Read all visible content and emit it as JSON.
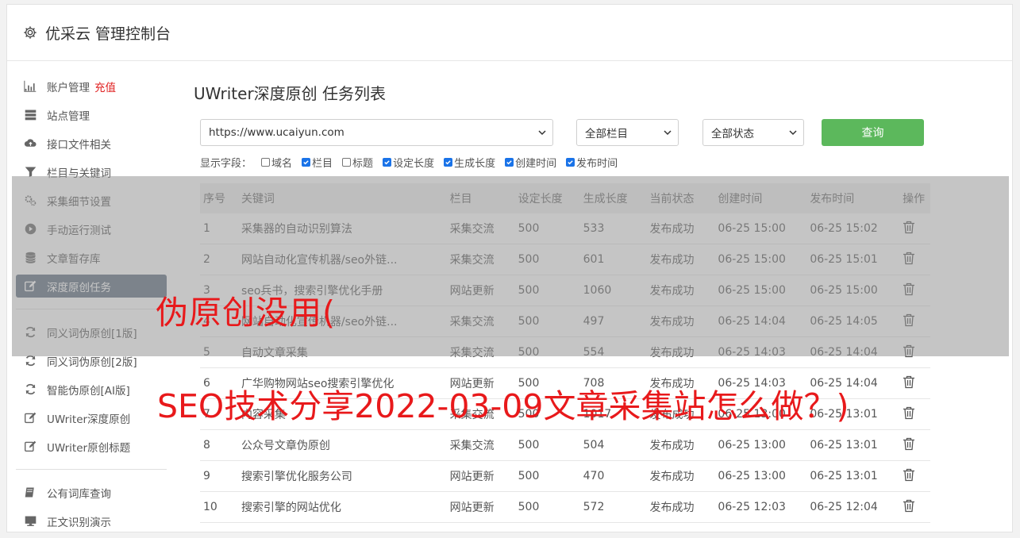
{
  "header": {
    "title": "优采云 管理控制台"
  },
  "sidebar": {
    "group1": [
      {
        "label": "账户管理",
        "extra": "充值",
        "icon": "bar-chart-icon"
      },
      {
        "label": "站点管理",
        "icon": "server-icon"
      },
      {
        "label": "接口文件相关",
        "icon": "cloud-upload-icon"
      },
      {
        "label": "栏目与关键词",
        "icon": "filter-icon"
      },
      {
        "label": "采集细节设置",
        "icon": "gears-icon"
      },
      {
        "label": "手动运行测试",
        "icon": "play-circle-icon"
      },
      {
        "label": "文章暂存库",
        "icon": "database-icon"
      },
      {
        "label": "深度原创任务",
        "icon": "edit-icon",
        "active": true
      }
    ],
    "group2": [
      {
        "label": "同义词伪原创[1版]",
        "icon": "refresh-icon"
      },
      {
        "label": "同义词伪原创[2版]",
        "icon": "refresh-icon"
      },
      {
        "label": "智能伪原创[AI版]",
        "icon": "refresh-icon"
      },
      {
        "label": "UWriter深度原创",
        "icon": "edit-icon"
      },
      {
        "label": "UWriter原创标题",
        "icon": "edit-icon"
      }
    ],
    "group3": [
      {
        "label": "公有词库查询",
        "icon": "book-icon"
      },
      {
        "label": "正文识别演示",
        "icon": "monitor-icon"
      }
    ]
  },
  "main": {
    "title": "UWriter深度原创 任务列表",
    "site_select": "https://www.ucaiyun.com",
    "column_select": "全部栏目",
    "status_select": "全部状态",
    "query_label": "查询",
    "fields_label": "显示字段：",
    "fields": [
      {
        "label": "域名",
        "checked": false
      },
      {
        "label": "栏目",
        "checked": true
      },
      {
        "label": "标题",
        "checked": false
      },
      {
        "label": "设定长度",
        "checked": true
      },
      {
        "label": "生成长度",
        "checked": true
      },
      {
        "label": "创建时间",
        "checked": true
      },
      {
        "label": "发布时间",
        "checked": true
      }
    ]
  },
  "table": {
    "headers": [
      "序号",
      "关键词",
      "栏目",
      "设定长度",
      "生成长度",
      "当前状态",
      "创建时间",
      "发布时间",
      "操作"
    ],
    "rows": [
      [
        "1",
        "采集器的自动识别算法",
        "采集交流",
        "500",
        "533",
        "发布成功",
        "06-25 15:00",
        "06-25 15:02"
      ],
      [
        "2",
        "网站自动化宣传机器/seo外链...",
        "采集交流",
        "500",
        "601",
        "发布成功",
        "06-25 15:00",
        "06-25 15:01"
      ],
      [
        "3",
        "seo兵书，搜索引擎优化手册",
        "网站更新",
        "500",
        "1060",
        "发布成功",
        "06-25 15:00",
        "06-25 15:00"
      ],
      [
        "4",
        "网站自动化宣传机器/seo外链...",
        "采集交流",
        "500",
        "497",
        "发布成功",
        "06-25 14:04",
        "06-25 14:05"
      ],
      [
        "5",
        "自动文章采集",
        "采集交流",
        "500",
        "554",
        "发布成功",
        "06-25 14:03",
        "06-25 14:04"
      ],
      [
        "6",
        "广华购物网站seo搜索引擎优化",
        "网站更新",
        "500",
        "708",
        "发布成功",
        "06-25 14:03",
        "06-25 14:04"
      ],
      [
        "7",
        "内容采集",
        "采集交流",
        "500",
        "1017",
        "发布成功",
        "06-25 13:00",
        "06-25 13:01"
      ],
      [
        "8",
        "公众号文章伪原创",
        "采集交流",
        "500",
        "504",
        "发布成功",
        "06-25 13:00",
        "06-25 13:01"
      ],
      [
        "9",
        "搜索引擎优化服务公司",
        "网站更新",
        "500",
        "470",
        "发布成功",
        "06-25 13:00",
        "06-25 13:01"
      ],
      [
        "10",
        "搜索引擎的网站优化",
        "网站更新",
        "500",
        "572",
        "发布成功",
        "06-25 12:03",
        "06-25 12:04"
      ]
    ]
  },
  "watermark": {
    "line1": "伪原创没用(",
    "line2": "SEO技术分享2022-03-09文章采集站怎么做？)"
  }
}
